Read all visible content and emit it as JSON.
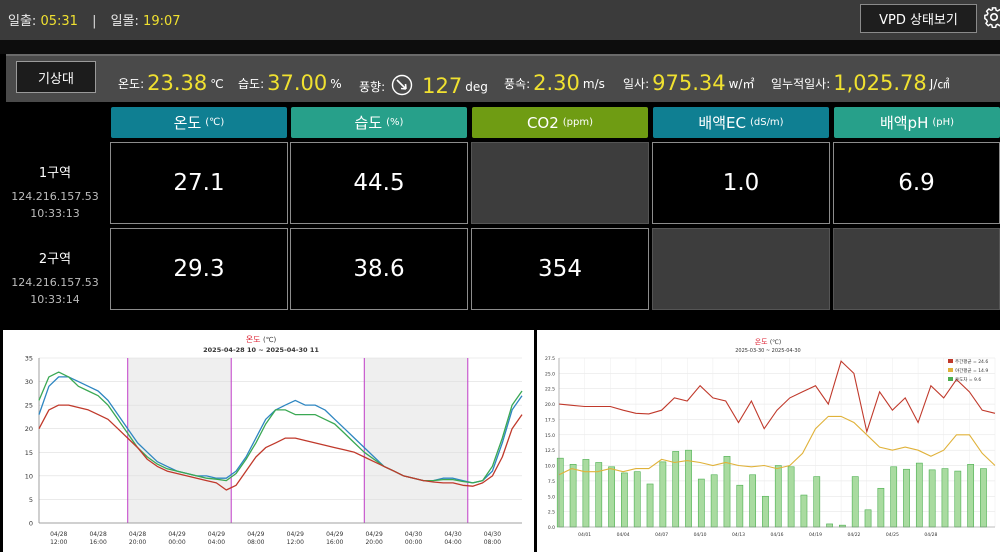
{
  "topbar": {
    "sunrise_label": "일출:",
    "sunrise": "05:31",
    "sunset_label": "일몰:",
    "sunset": "19:07",
    "separator": "|",
    "vpd_button": "VPD 상태보기"
  },
  "weather": {
    "button": "기상대",
    "temp_label": "온도:",
    "temp": "23.38",
    "temp_unit": "℃",
    "hum_label": "습도:",
    "hum": "37.00",
    "hum_unit": "%",
    "wind_dir_label": "풍향:",
    "wind_dir": "127",
    "wind_dir_unit": "deg",
    "wind_speed_label": "풍속:",
    "wind_speed": "2.30",
    "wind_speed_unit": "m/s",
    "solar_label": "일사:",
    "solar": "975.34",
    "solar_unit": "w/㎡",
    "cum_solar_label": "일누적일사:",
    "cum_solar": "1,025.78",
    "cum_solar_unit": "J/㎠"
  },
  "columns": [
    {
      "name": "온도",
      "unit": "(℃)",
      "color": "#0f7f92"
    },
    {
      "name": "습도",
      "unit": "(%)",
      "color": "#27a08a"
    },
    {
      "name": "CO2",
      "unit": "(ppm)",
      "color": "#6f9c13"
    },
    {
      "name": "배액EC",
      "unit": "(dS/m)",
      "color": "#0f7f92"
    },
    {
      "name": "배액pH",
      "unit": "(pH)",
      "color": "#27a08a"
    }
  ],
  "zones": [
    {
      "name": "1구역",
      "ip": "124.216.157.53",
      "time": "10:33:13",
      "values": [
        "27.1",
        "44.5",
        "",
        "1.0",
        "6.9"
      ]
    },
    {
      "name": "2구역",
      "ip": "124.216.157.53",
      "time": "10:33:14",
      "values": [
        "29.3",
        "38.6",
        "354",
        "",
        ""
      ]
    }
  ],
  "chart_data": [
    {
      "type": "line",
      "title": "온도",
      "title_unit": "(℃)",
      "subtitle": "2025-04-28 10 ~ 2025-04-30 11",
      "ylim": [
        0,
        35
      ],
      "yticks": [
        0,
        5,
        10,
        15,
        20,
        25,
        30,
        35
      ],
      "xlim": [
        0,
        49
      ],
      "xticks": [
        {
          "x": 2,
          "l1": "04/28",
          "l2": "12:00"
        },
        {
          "x": 6,
          "l1": "04/28",
          "l2": "16:00"
        },
        {
          "x": 10,
          "l1": "04/28",
          "l2": "20:00"
        },
        {
          "x": 14,
          "l1": "04/29",
          "l2": "00:00"
        },
        {
          "x": 18,
          "l1": "04/29",
          "l2": "04:00"
        },
        {
          "x": 22,
          "l1": "04/29",
          "l2": "08:00"
        },
        {
          "x": 26,
          "l1": "04/29",
          "l2": "12:00"
        },
        {
          "x": 30,
          "l1": "04/29",
          "l2": "16:00"
        },
        {
          "x": 34,
          "l1": "04/29",
          "l2": "20:00"
        },
        {
          "x": 38,
          "l1": "04/30",
          "l2": "00:00"
        },
        {
          "x": 42,
          "l1": "04/30",
          "l2": "04:00"
        },
        {
          "x": 46,
          "l1": "04/30",
          "l2": "08:00"
        }
      ],
      "night_bands": [
        [
          9,
          19.5
        ],
        [
          33,
          43.5
        ]
      ],
      "markers": [
        9,
        19.5,
        33,
        43.5
      ],
      "series": [
        {
          "color": "#2e86c1",
          "x": [
            0,
            1,
            2,
            3,
            4,
            5,
            6,
            7,
            8,
            9,
            10,
            11,
            12,
            13,
            14,
            15,
            16,
            17,
            18,
            19,
            20,
            21,
            22,
            23,
            24,
            25,
            26,
            27,
            28,
            29,
            30,
            31,
            32,
            33,
            34,
            35,
            36,
            37,
            38,
            39,
            40,
            41,
            42,
            43,
            44,
            45,
            46,
            47,
            48,
            49
          ],
          "values": [
            23,
            29,
            31,
            31,
            30,
            29,
            28,
            26,
            23,
            20,
            17,
            15,
            13,
            12,
            11,
            10.5,
            10,
            10,
            9.5,
            9.5,
            11,
            14,
            18,
            22,
            24,
            25,
            26,
            25,
            25,
            24,
            22,
            20,
            18,
            16,
            14,
            12,
            11,
            10,
            9.5,
            9,
            9,
            9.5,
            9.5,
            9,
            8.5,
            9,
            11,
            17,
            24,
            27
          ]
        },
        {
          "color": "#3aa853",
          "x": [
            0,
            1,
            2,
            3,
            4,
            5,
            6,
            7,
            8,
            9,
            10,
            11,
            12,
            13,
            14,
            15,
            16,
            17,
            18,
            19,
            20,
            21,
            22,
            23,
            24,
            25,
            26,
            27,
            28,
            29,
            30,
            31,
            32,
            33,
            34,
            35,
            36,
            37,
            38,
            39,
            40,
            41,
            42,
            43,
            44,
            45,
            46,
            47,
            48,
            49
          ],
          "values": [
            26,
            31,
            32,
            31,
            29,
            28,
            27,
            25,
            22,
            19,
            16,
            14,
            12.5,
            11.5,
            11,
            10.5,
            10,
            9.5,
            9.3,
            9,
            10.5,
            13.5,
            17,
            21,
            24,
            24,
            23,
            23,
            23,
            22,
            21,
            19,
            17,
            15,
            13.5,
            12,
            11,
            10,
            9.5,
            9,
            9,
            9.2,
            9.2,
            8.8,
            8.5,
            9,
            12,
            18,
            25,
            28
          ]
        },
        {
          "color": "#c0392b",
          "x": [
            0,
            1,
            2,
            3,
            4,
            5,
            6,
            7,
            8,
            9,
            10,
            11,
            12,
            13,
            14,
            15,
            16,
            17,
            18,
            19,
            20,
            21,
            22,
            23,
            24,
            25,
            26,
            27,
            28,
            29,
            30,
            31,
            32,
            33,
            34,
            35,
            36,
            37,
            38,
            39,
            40,
            41,
            42,
            43,
            44,
            45,
            46,
            47,
            48,
            49
          ],
          "values": [
            20,
            24,
            25,
            25,
            24.5,
            24,
            23,
            22,
            20,
            18,
            16,
            13.5,
            12,
            11,
            10.5,
            10,
            9.5,
            9,
            8.5,
            7,
            8,
            11,
            14,
            16,
            17,
            18,
            18,
            17.5,
            17,
            16.5,
            16,
            15.5,
            15,
            14,
            13,
            12,
            11,
            10,
            9.5,
            9,
            8.7,
            8.5,
            8.5,
            8,
            7.8,
            8.5,
            10,
            14,
            20,
            23
          ]
        }
      ]
    },
    {
      "type": "bar-line",
      "title": "온도",
      "title_unit": "(℃)",
      "subtitle": "2025-03-30 ~ 2025-04-30",
      "ylim": [
        0,
        27.5
      ],
      "yticks": [
        0,
        2.5,
        5.0,
        7.5,
        10.0,
        12.5,
        15.0,
        17.5,
        20.0,
        22.5,
        25.0,
        27.5
      ],
      "xticks": [
        "04/01",
        "04/04",
        "04/07",
        "04/10",
        "04/13",
        "04/16",
        "04/19",
        "04/22",
        "04/25",
        "04/28"
      ],
      "xtick_index": [
        2,
        5,
        8,
        11,
        14,
        17,
        20,
        23,
        26,
        29
      ],
      "legend": [
        {
          "label": "주간평균 = 24.6",
          "color": "#c0392b"
        },
        {
          "label": "야간평균 = 14.9",
          "color": "#e0b23a"
        },
        {
          "label": "온도차 = 9.6",
          "color": "#4caf50"
        }
      ],
      "day_avg": [
        20,
        19.8,
        19.6,
        19.6,
        19.6,
        19,
        18.5,
        18.4,
        19,
        21,
        20.5,
        23,
        21,
        20.5,
        17,
        20.5,
        16,
        19,
        21,
        22,
        23,
        20,
        27,
        25,
        15.5,
        22,
        19,
        21,
        17,
        23,
        21,
        24,
        22,
        19,
        18.5
      ],
      "night_avg": [
        8.5,
        9.5,
        9.0,
        9.0,
        9.5,
        9.0,
        9.5,
        9.5,
        11,
        10.5,
        10.8,
        10.5,
        10.0,
        10.5,
        10,
        9.8,
        10,
        9.5,
        10,
        12,
        16,
        18,
        18,
        17,
        15,
        13,
        12.5,
        13,
        12.5,
        11.5,
        12.5,
        15,
        15,
        12,
        10
      ],
      "diff": [
        11.2,
        10.2,
        11,
        10.5,
        9.8,
        8.8,
        9,
        7,
        10.6,
        12.3,
        12.5,
        7.8,
        8.5,
        11.5,
        6.8,
        8.5,
        5,
        10,
        9.8,
        5.2,
        8.2,
        0.5,
        0.3,
        8.2,
        2.8,
        6.3,
        9.8,
        9.4,
        10.4,
        9.3,
        9.5,
        9.1,
        10.2,
        9.5
      ]
    }
  ]
}
